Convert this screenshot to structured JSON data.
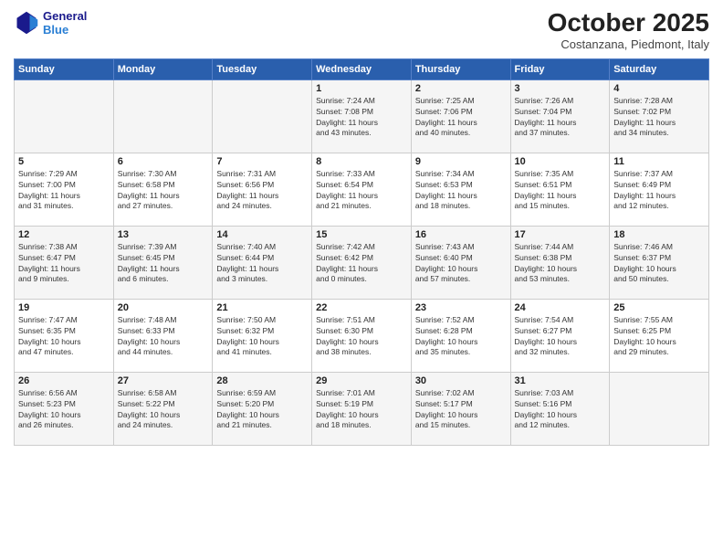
{
  "logo": {
    "line1": "General",
    "line2": "Blue"
  },
  "title": "October 2025",
  "subtitle": "Costanzana, Piedmont, Italy",
  "days_of_week": [
    "Sunday",
    "Monday",
    "Tuesday",
    "Wednesday",
    "Thursday",
    "Friday",
    "Saturday"
  ],
  "weeks": [
    [
      {
        "num": "",
        "info": ""
      },
      {
        "num": "",
        "info": ""
      },
      {
        "num": "",
        "info": ""
      },
      {
        "num": "1",
        "info": "Sunrise: 7:24 AM\nSunset: 7:08 PM\nDaylight: 11 hours\nand 43 minutes."
      },
      {
        "num": "2",
        "info": "Sunrise: 7:25 AM\nSunset: 7:06 PM\nDaylight: 11 hours\nand 40 minutes."
      },
      {
        "num": "3",
        "info": "Sunrise: 7:26 AM\nSunset: 7:04 PM\nDaylight: 11 hours\nand 37 minutes."
      },
      {
        "num": "4",
        "info": "Sunrise: 7:28 AM\nSunset: 7:02 PM\nDaylight: 11 hours\nand 34 minutes."
      }
    ],
    [
      {
        "num": "5",
        "info": "Sunrise: 7:29 AM\nSunset: 7:00 PM\nDaylight: 11 hours\nand 31 minutes."
      },
      {
        "num": "6",
        "info": "Sunrise: 7:30 AM\nSunset: 6:58 PM\nDaylight: 11 hours\nand 27 minutes."
      },
      {
        "num": "7",
        "info": "Sunrise: 7:31 AM\nSunset: 6:56 PM\nDaylight: 11 hours\nand 24 minutes."
      },
      {
        "num": "8",
        "info": "Sunrise: 7:33 AM\nSunset: 6:54 PM\nDaylight: 11 hours\nand 21 minutes."
      },
      {
        "num": "9",
        "info": "Sunrise: 7:34 AM\nSunset: 6:53 PM\nDaylight: 11 hours\nand 18 minutes."
      },
      {
        "num": "10",
        "info": "Sunrise: 7:35 AM\nSunset: 6:51 PM\nDaylight: 11 hours\nand 15 minutes."
      },
      {
        "num": "11",
        "info": "Sunrise: 7:37 AM\nSunset: 6:49 PM\nDaylight: 11 hours\nand 12 minutes."
      }
    ],
    [
      {
        "num": "12",
        "info": "Sunrise: 7:38 AM\nSunset: 6:47 PM\nDaylight: 11 hours\nand 9 minutes."
      },
      {
        "num": "13",
        "info": "Sunrise: 7:39 AM\nSunset: 6:45 PM\nDaylight: 11 hours\nand 6 minutes."
      },
      {
        "num": "14",
        "info": "Sunrise: 7:40 AM\nSunset: 6:44 PM\nDaylight: 11 hours\nand 3 minutes."
      },
      {
        "num": "15",
        "info": "Sunrise: 7:42 AM\nSunset: 6:42 PM\nDaylight: 11 hours\nand 0 minutes."
      },
      {
        "num": "16",
        "info": "Sunrise: 7:43 AM\nSunset: 6:40 PM\nDaylight: 10 hours\nand 57 minutes."
      },
      {
        "num": "17",
        "info": "Sunrise: 7:44 AM\nSunset: 6:38 PM\nDaylight: 10 hours\nand 53 minutes."
      },
      {
        "num": "18",
        "info": "Sunrise: 7:46 AM\nSunset: 6:37 PM\nDaylight: 10 hours\nand 50 minutes."
      }
    ],
    [
      {
        "num": "19",
        "info": "Sunrise: 7:47 AM\nSunset: 6:35 PM\nDaylight: 10 hours\nand 47 minutes."
      },
      {
        "num": "20",
        "info": "Sunrise: 7:48 AM\nSunset: 6:33 PM\nDaylight: 10 hours\nand 44 minutes."
      },
      {
        "num": "21",
        "info": "Sunrise: 7:50 AM\nSunset: 6:32 PM\nDaylight: 10 hours\nand 41 minutes."
      },
      {
        "num": "22",
        "info": "Sunrise: 7:51 AM\nSunset: 6:30 PM\nDaylight: 10 hours\nand 38 minutes."
      },
      {
        "num": "23",
        "info": "Sunrise: 7:52 AM\nSunset: 6:28 PM\nDaylight: 10 hours\nand 35 minutes."
      },
      {
        "num": "24",
        "info": "Sunrise: 7:54 AM\nSunset: 6:27 PM\nDaylight: 10 hours\nand 32 minutes."
      },
      {
        "num": "25",
        "info": "Sunrise: 7:55 AM\nSunset: 6:25 PM\nDaylight: 10 hours\nand 29 minutes."
      }
    ],
    [
      {
        "num": "26",
        "info": "Sunrise: 6:56 AM\nSunset: 5:23 PM\nDaylight: 10 hours\nand 26 minutes."
      },
      {
        "num": "27",
        "info": "Sunrise: 6:58 AM\nSunset: 5:22 PM\nDaylight: 10 hours\nand 24 minutes."
      },
      {
        "num": "28",
        "info": "Sunrise: 6:59 AM\nSunset: 5:20 PM\nDaylight: 10 hours\nand 21 minutes."
      },
      {
        "num": "29",
        "info": "Sunrise: 7:01 AM\nSunset: 5:19 PM\nDaylight: 10 hours\nand 18 minutes."
      },
      {
        "num": "30",
        "info": "Sunrise: 7:02 AM\nSunset: 5:17 PM\nDaylight: 10 hours\nand 15 minutes."
      },
      {
        "num": "31",
        "info": "Sunrise: 7:03 AM\nSunset: 5:16 PM\nDaylight: 10 hours\nand 12 minutes."
      },
      {
        "num": "",
        "info": ""
      }
    ]
  ]
}
